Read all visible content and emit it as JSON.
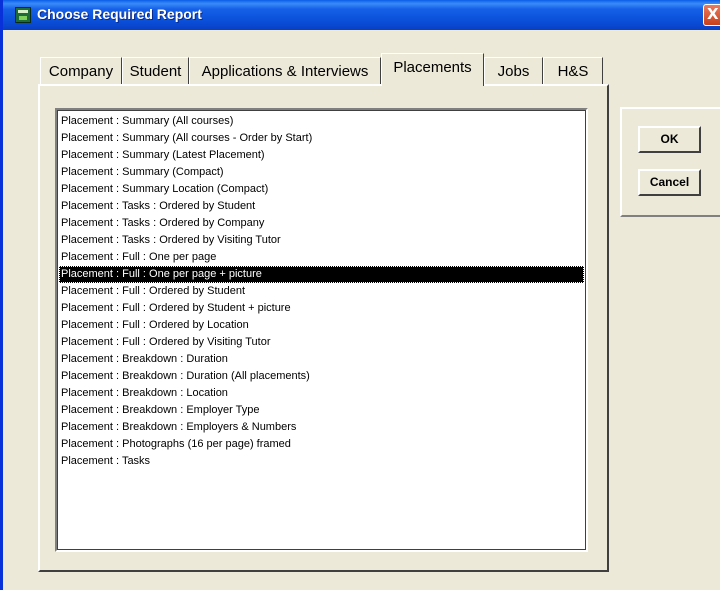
{
  "window": {
    "title": "Choose Required Report",
    "close_glyph": "X"
  },
  "tabs": [
    {
      "label": "Company"
    },
    {
      "label": "Student"
    },
    {
      "label": "Applications & Interviews"
    },
    {
      "label": "Placements"
    },
    {
      "label": "Jobs"
    },
    {
      "label": "H&S"
    }
  ],
  "active_tab": "Placements",
  "reports": {
    "selected": "Placement : Full : One per page + picture",
    "items": [
      "Placement : Summary (All courses)",
      "Placement : Summary (All courses - Order by Start)",
      "Placement : Summary (Latest Placement)",
      "Placement : Summary (Compact)",
      "Placement : Summary Location (Compact)",
      "Placement : Tasks : Ordered by Student",
      "Placement : Tasks : Ordered by Company",
      "Placement : Tasks : Ordered by Visiting Tutor",
      "Placement : Full : One per page",
      "Placement : Full : One per page + picture",
      "Placement : Full : Ordered by Student",
      "Placement : Full : Ordered by Student + picture",
      "Placement : Full : Ordered by Location",
      "Placement : Full : Ordered by Visiting Tutor",
      "Placement : Breakdown : Duration",
      "Placement : Breakdown : Duration (All placements)",
      "Placement : Breakdown : Location",
      "Placement : Breakdown : Employer Type",
      "Placement : Breakdown : Employers &  Numbers",
      "Placement : Photographs (16 per page) framed",
      "Placement : Tasks"
    ]
  },
  "buttons": {
    "ok": "OK",
    "cancel": "Cancel"
  },
  "colors": {
    "titlebar": "#0a4fd8",
    "dialog_bg": "#ece9d8",
    "selection_bg": "#000000",
    "selection_fg": "#ffffff"
  }
}
